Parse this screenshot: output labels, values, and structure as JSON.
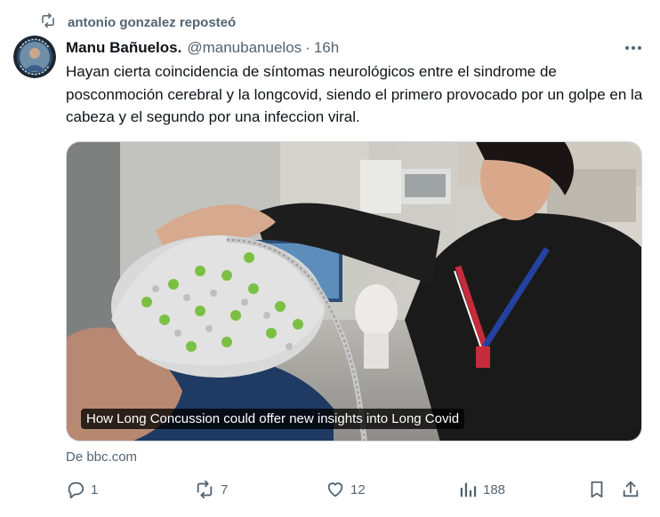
{
  "repost": {
    "label": "antonio gonzalez reposteó",
    "icon": "repost-icon"
  },
  "author": {
    "name": "Manu Bañuelos.",
    "handle": "@manubanuelos",
    "separator": "·",
    "time": "16h"
  },
  "tweet": {
    "text": "Hayan cierta coincidencia de síntomas neurológicos entre el sindrome de posconmoción cerebral y la longcovid, siendo el primero provocado por un golpe en la cabeza y el segundo por una infeccion viral."
  },
  "card": {
    "caption": "How Long Concussion could offer new insights into Long Covid",
    "source": "De bbc.com"
  },
  "actions": {
    "replies": "1",
    "reposts": "7",
    "likes": "12",
    "views": "188"
  },
  "colors": {
    "secondary_text": "#536471",
    "primary_text": "#0f1419",
    "border": "#cfd9de"
  }
}
